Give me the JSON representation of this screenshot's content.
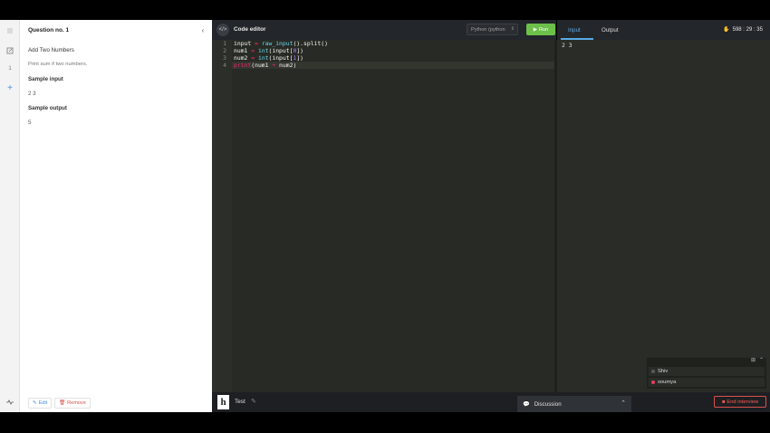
{
  "question": {
    "title": "Question no. 1",
    "name": "Add Two Numbers",
    "description": "Print sum if two numbers.",
    "sample_input_label": "Sample input",
    "sample_input_value": "2 3",
    "sample_output_label": "Sample output",
    "sample_output_value": "5",
    "edit_label": "Edit",
    "remove_label": "Remove",
    "collapse_icon": "chevron-left-icon"
  },
  "rail": {
    "items": [
      {
        "icon": "list-icon"
      },
      {
        "icon": "edit-note-icon"
      },
      {
        "label": "1"
      },
      {
        "icon": "plus-icon"
      }
    ],
    "bottom_icon": "activity-icon"
  },
  "editor": {
    "title": "Code editor",
    "language": "Python (python",
    "run_label": "Run",
    "line_numbers": [
      "1",
      "2",
      "3",
      "4"
    ]
  },
  "io": {
    "tabs": [
      "Input",
      "Output"
    ],
    "active_tab": "Input",
    "input_value": "2 3",
    "timer": "598 : 29 : 35"
  },
  "participants": [
    {
      "name": "Shiv",
      "status_color": "#5a5a5a"
    },
    {
      "name": "soumya",
      "status_color": "#e83e5a"
    }
  ],
  "bottom": {
    "logo": "h",
    "test_label": "Test",
    "discussion_label": "Discussion",
    "end_label": "End interview"
  },
  "colors": {
    "run_green": "#6cc04a",
    "tab_blue": "#5aa9e6",
    "end_red": "#ff5a55"
  }
}
